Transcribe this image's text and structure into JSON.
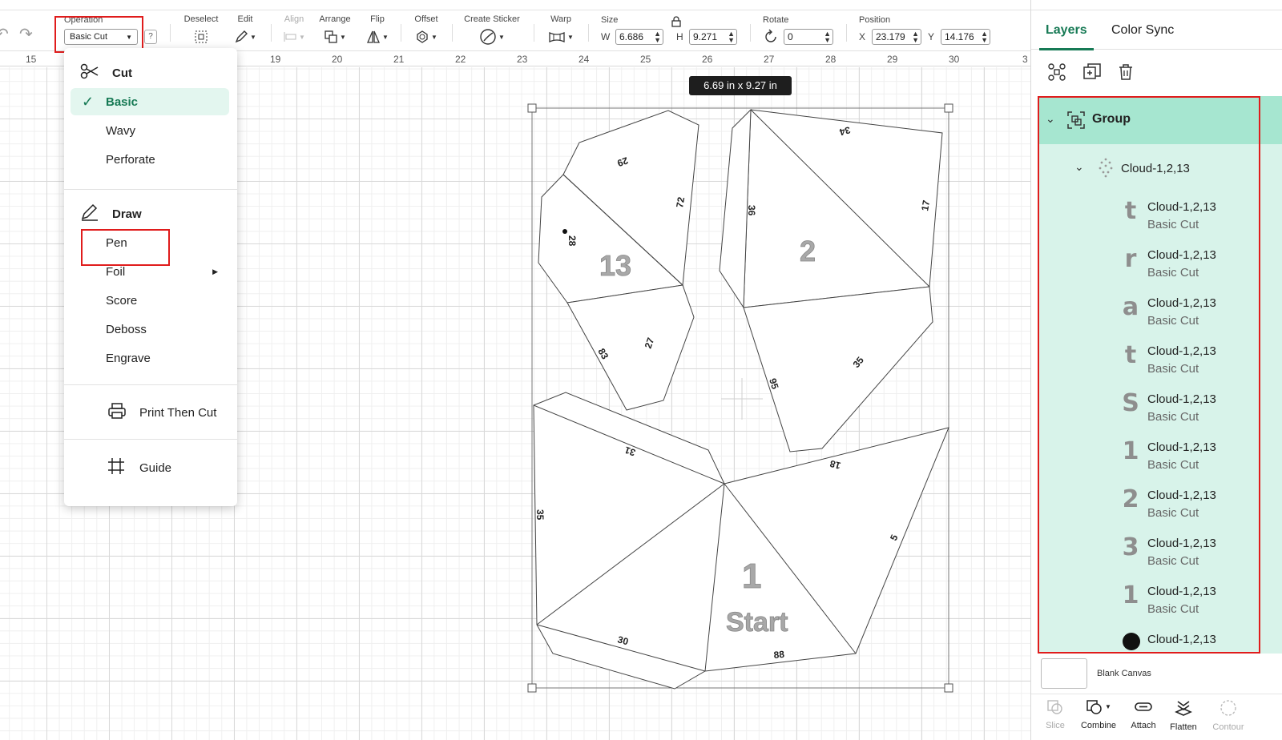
{
  "toolbar": {
    "operation_label": "Operation",
    "operation_value": "Basic Cut",
    "help": "?",
    "deselect": "Deselect",
    "edit": "Edit",
    "align": "Align",
    "arrange": "Arrange",
    "flip": "Flip",
    "offset": "Offset",
    "create_sticker": "Create Sticker",
    "warp": "Warp",
    "size": "Size",
    "w_label": "W",
    "w_value": "6.686",
    "h_label": "H",
    "h_value": "9.271",
    "rotate": "Rotate",
    "rotate_value": "0",
    "position": "Position",
    "x_label": "X",
    "x_value": "23.179",
    "y_label": "Y",
    "y_value": "14.176"
  },
  "ruler": {
    "ticks": [
      "15",
      "19",
      "20",
      "21",
      "22",
      "23",
      "24",
      "25",
      "26",
      "27",
      "28",
      "29",
      "30",
      "3"
    ]
  },
  "canvas": {
    "size_badge": "6.69  in x 9.27  in",
    "piece_numbers": [
      "13",
      "2",
      "1"
    ],
    "start_label": "Start",
    "edge_numbers": [
      "29",
      "72",
      "28",
      "83",
      "27",
      "34",
      "36",
      "17",
      "95",
      "35",
      "31",
      "18",
      "35",
      "5",
      "30",
      "88"
    ]
  },
  "operation_menu": {
    "cut_header": "Cut",
    "cut_items": [
      "Basic",
      "Wavy",
      "Perforate"
    ],
    "selected": "Basic",
    "draw_header": "Draw",
    "draw_items": [
      "Pen",
      "Foil",
      "Score",
      "Deboss",
      "Engrave"
    ],
    "print_then_cut": "Print Then Cut",
    "guide": "Guide"
  },
  "panel": {
    "tabs": [
      "Layers",
      "Color Sync"
    ],
    "group_name": "Group",
    "subgroup_name": "Cloud-1,2,13",
    "layers": [
      {
        "glyph": "t",
        "name": "Cloud-1,2,13",
        "op": "Basic Cut"
      },
      {
        "glyph": "r",
        "name": "Cloud-1,2,13",
        "op": "Basic Cut"
      },
      {
        "glyph": "a",
        "name": "Cloud-1,2,13",
        "op": "Basic Cut"
      },
      {
        "glyph": "t",
        "name": "Cloud-1,2,13",
        "op": "Basic Cut"
      },
      {
        "glyph": "S",
        "name": "Cloud-1,2,13",
        "op": "Basic Cut"
      },
      {
        "glyph": "1",
        "name": "Cloud-1,2,13",
        "op": "Basic Cut"
      },
      {
        "glyph": "2",
        "name": "Cloud-1,2,13",
        "op": "Basic Cut"
      },
      {
        "glyph": "3",
        "name": "Cloud-1,2,13",
        "op": "Basic Cut"
      },
      {
        "glyph": "1",
        "name": "Cloud-1,2,13",
        "op": "Basic Cut"
      },
      {
        "glyph": "",
        "name": "Cloud-1,2,13",
        "op": ""
      }
    ],
    "blank_canvas": "Blank Canvas",
    "bottom_tools": [
      "Slice",
      "Combine",
      "Attach",
      "Flatten",
      "Contour"
    ]
  },
  "colors": {
    "accent": "#177a55",
    "layer_bg": "#d8f3ea",
    "group_bg": "#a6e6d0",
    "highlight": "#e01c1c"
  }
}
